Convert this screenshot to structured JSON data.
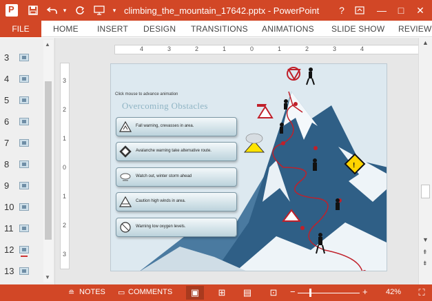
{
  "titlebar": {
    "title": "climbing_the_mountain_17642.pptx - PowerPoint",
    "help": "?",
    "minimize": "—",
    "maximize": "□",
    "close": "✕",
    "save_icon": "save-icon",
    "undo_icon": "undo-icon",
    "redo_icon": "redo-icon"
  },
  "ribbon": {
    "file": "FILE",
    "tabs": [
      "HOME",
      "INSERT",
      "DESIGN",
      "TRANSITIONS",
      "ANIMATIONS",
      "SLIDE SHOW",
      "REVIEW"
    ]
  },
  "thumbnails": [
    "3",
    "4",
    "5",
    "6",
    "7",
    "8",
    "9",
    "10",
    "11",
    "12",
    "13"
  ],
  "ruler": {
    "h_labels": [
      "4",
      "3",
      "2",
      "1",
      "0",
      "1",
      "2",
      "3",
      "4"
    ],
    "v_labels": [
      "3",
      "2",
      "1",
      "0",
      "1",
      "2",
      "3"
    ]
  },
  "slide": {
    "hint": "Click mouse to advance animation",
    "title": "Overcoming Obstacles",
    "obstacles": [
      "Fall warning, crevasses in area.",
      "Avalanche warning take alternative route.",
      "Watch out, winter storm ahead",
      "Caution high winds in area.",
      "Warning low oxygen levels."
    ],
    "colors": {
      "sky": "#dfeaf1",
      "mountain": "#3f6f93",
      "snow": "#f4f8fb",
      "path": "#c0202a"
    }
  },
  "statusbar": {
    "notes": "NOTES",
    "comments": "COMMENTS",
    "zoom": "42%",
    "zoom_level": 0.42,
    "minus": "−",
    "plus": "+"
  }
}
